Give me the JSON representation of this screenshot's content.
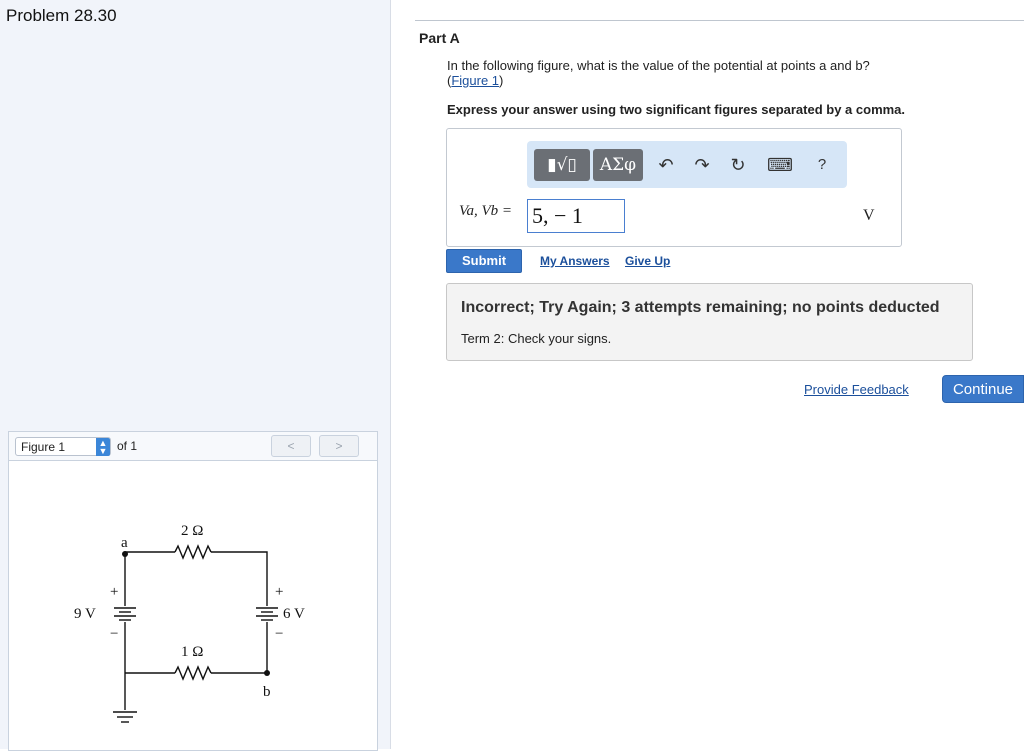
{
  "problem": {
    "title": "Problem 28.30"
  },
  "figure_panel": {
    "selected": "Figure 1",
    "of_label": "of 1",
    "prev_glyph": "<",
    "next_glyph": ">",
    "circuit_labels": {
      "top_resistor": "2 Ω",
      "bottom_resistor": "1 Ω",
      "left_battery": "9 V",
      "right_battery": "6 V",
      "point_a": "a",
      "point_b": "b",
      "plus_left": "+",
      "minus_left": "−",
      "plus_right": "+",
      "minus_right": "−"
    }
  },
  "part": {
    "label": "Part A",
    "question": "In the following figure, what is the value of the potential at points a and b?",
    "figure_link_open": "(",
    "figure_link": "Figure 1",
    "figure_link_close": ")",
    "instruction": "Express your answer using two significant figures separated by a comma."
  },
  "answer": {
    "templates_label": "▮√▯",
    "symbols_label": "ΑΣφ",
    "undo_icon": "↶",
    "redo_icon": "↷",
    "reset_icon": "↻",
    "keyboard_icon": "⌨",
    "help_label": "?",
    "variable_label": "Va, Vb =",
    "value": "5, − 1",
    "unit": "V"
  },
  "actions": {
    "submit": "Submit",
    "my_answers": "My Answers",
    "give_up": "Give Up"
  },
  "feedback": {
    "title": "Incorrect; Try Again; 3 attempts remaining; no points deducted",
    "detail": "Term 2: Check your signs."
  },
  "footer": {
    "provide_feedback": "Provide Feedback",
    "continue": "Continue"
  }
}
